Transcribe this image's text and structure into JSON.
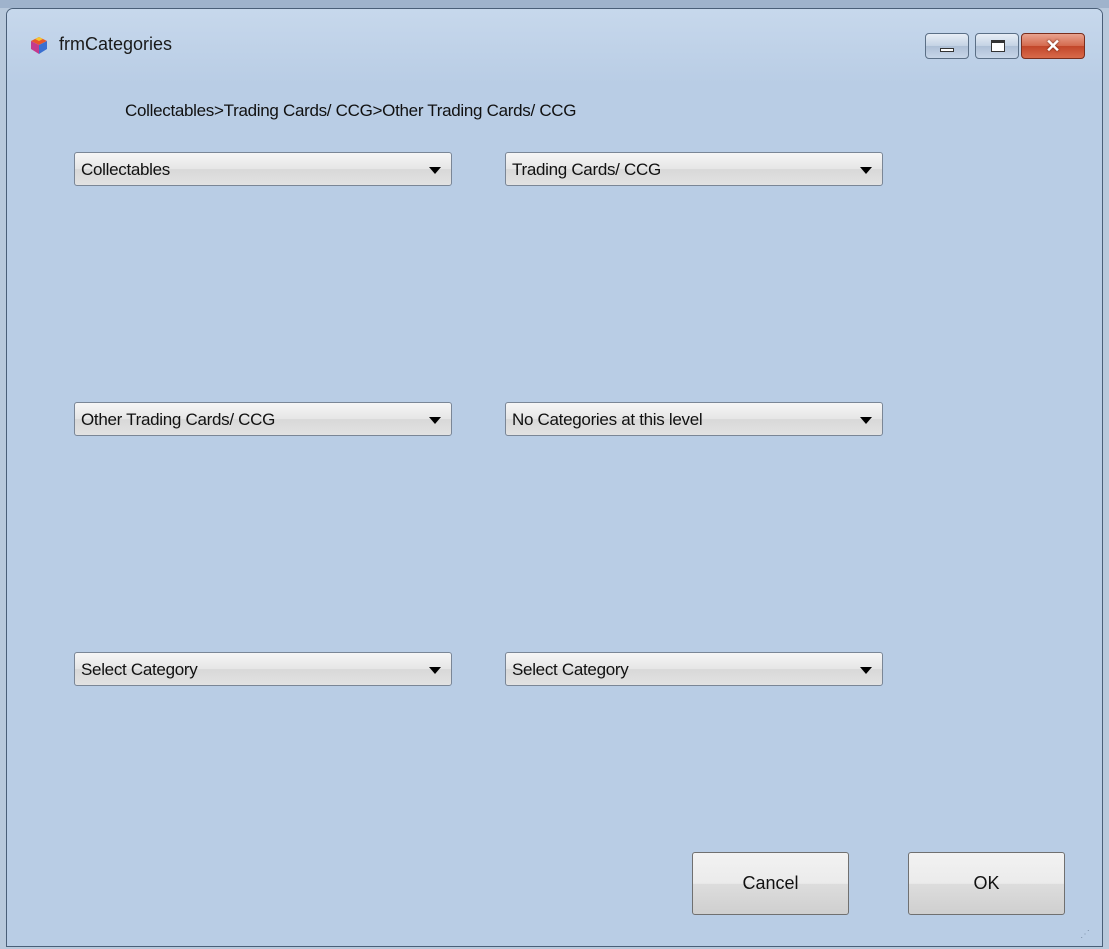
{
  "window": {
    "title": "frmCategories",
    "controls": {
      "close_glyph": "✕"
    }
  },
  "breadcrumb": "Collectables>Trading Cards/ CCG>Other Trading Cards/ CCG",
  "combos": [
    {
      "value": "Collectables"
    },
    {
      "value": "Trading Cards/ CCG"
    },
    {
      "value": "Other Trading Cards/ CCG"
    },
    {
      "value": "No Categories at this level"
    },
    {
      "value": "Select Category"
    },
    {
      "value": "Select Category"
    }
  ],
  "buttons": {
    "cancel": "Cancel",
    "ok": "OK"
  },
  "colors": {
    "form_background": "#b9cde5",
    "close_button": "#c2462a"
  }
}
